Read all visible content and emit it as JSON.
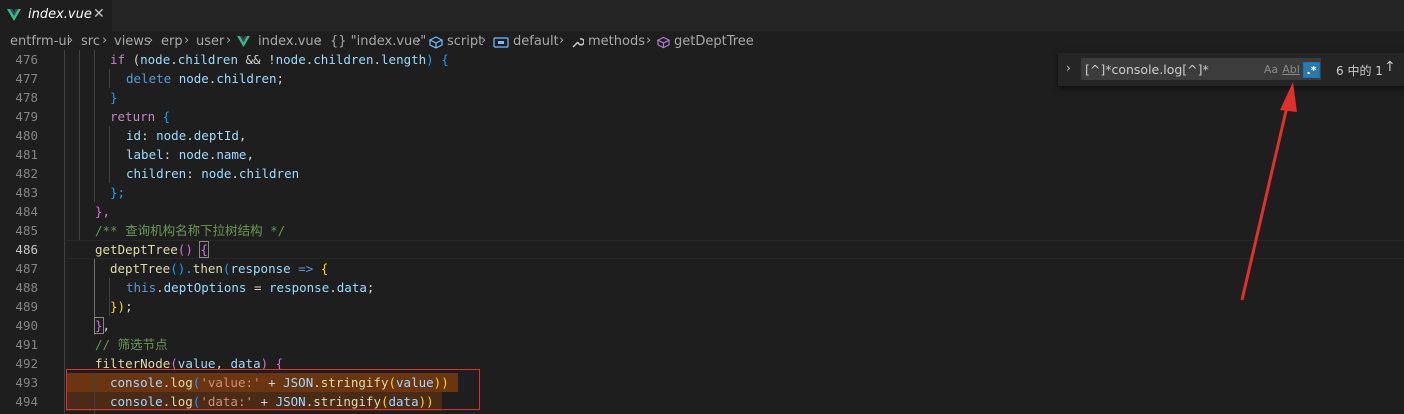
{
  "tab": {
    "title": "index.vue",
    "close": "✕"
  },
  "breadcrumb": [
    "entfrm-ui",
    "src",
    "views",
    "erp",
    "user",
    "index.vue",
    "{} \"index.vue\"",
    "script",
    "default",
    "methods",
    "getDeptTree"
  ],
  "find": {
    "toggle": "›",
    "query": "[^]*console.log[^]*",
    "match_case": "Aa",
    "whole_word": "Abl",
    "regex": ".*",
    "count": "6 中的 1",
    "prev": "↑"
  },
  "line_numbers": [
    "476",
    "477",
    "478",
    "479",
    "480",
    "481",
    "482",
    "483",
    "484",
    "485",
    "486",
    "487",
    "488",
    "489",
    "490",
    "491",
    "492",
    "493",
    "494"
  ],
  "active_line": "486",
  "code": {
    "l476": [
      "if",
      " (",
      "node",
      ".",
      "children",
      " && !",
      "node",
      ".",
      "children",
      ".",
      "length",
      ") {"
    ],
    "l477": [
      "delete",
      " ",
      "node",
      ".",
      "children",
      ";"
    ],
    "l478": [
      "}"
    ],
    "l479": [
      "return",
      " {"
    ],
    "l480": [
      "id",
      ": ",
      "node",
      ".",
      "deptId",
      ","
    ],
    "l481": [
      "label",
      ": ",
      "node",
      ".",
      "name",
      ","
    ],
    "l482": [
      "children",
      ": ",
      "node",
      ".",
      "children"
    ],
    "l483": [
      "};"
    ],
    "l484": [
      "},"
    ],
    "l485": [
      "/** 查询机构名称下拉树结构 */"
    ],
    "l486": [
      "getDeptTree",
      "() ",
      "{"
    ],
    "l487": [
      "deptTree",
      "().",
      "then",
      "(",
      "response",
      " => ",
      "{"
    ],
    "l488": [
      "this",
      ".",
      "deptOptions",
      " = ",
      "response",
      ".",
      "data",
      ";"
    ],
    "l489": [
      "})",
      ";"
    ],
    "l490": [
      "}",
      ","
    ],
    "l491": [
      "// 筛选节点"
    ],
    "l492": [
      "filterNode",
      "(",
      "value",
      ", ",
      "data",
      ") {"
    ],
    "l493": [
      "console",
      ".",
      "log",
      "(",
      "'value:'",
      " + ",
      "JSON",
      ".",
      "stringify",
      "(",
      "value",
      "))"
    ],
    "l494": [
      "console",
      ".",
      "log",
      "(",
      "'data:'",
      " + ",
      "JSON",
      ".",
      "stringify",
      "(",
      "data",
      "))"
    ]
  },
  "colors": {
    "background": "#1e1e1e",
    "keyword": "#c586c0",
    "function": "#dcdcaa",
    "variable": "#9cdcfe",
    "string": "#ce9178",
    "comment": "#6a9955",
    "find_match": "#ea5c00",
    "annotation_red": "#e0302b"
  }
}
